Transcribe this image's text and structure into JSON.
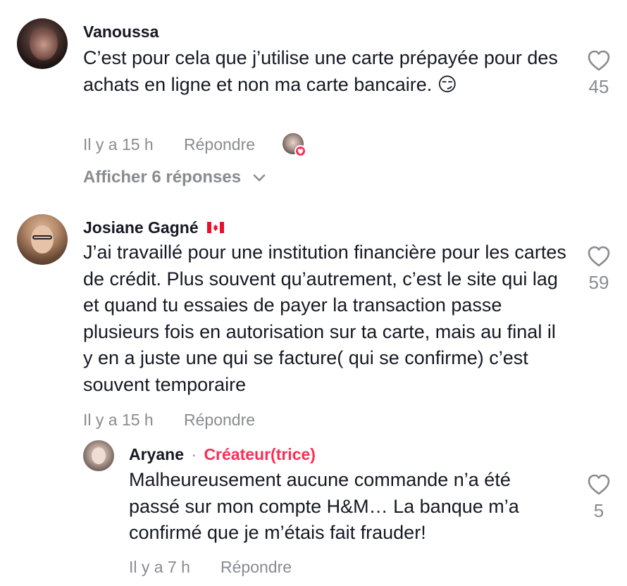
{
  "comments": [
    {
      "username": "Vanoussa",
      "text": "C’est pour cela que j’utilise une carte prépayée pour des achats en ligne et non ma carte bancaire. 😏",
      "time": "Il y a 15 h",
      "reply_label": "Répondre",
      "likes": "45",
      "view_replies": "Afficher 6 réponses",
      "creator_liked": true
    },
    {
      "username": "Josiane Gagné",
      "flag": "canada-flag",
      "text": "J’ai travaillé pour une institution financière pour les cartes de crédit. Plus souvent qu’autrement, c’est le site qui lag et quand tu essaies de payer la transaction passe plusieurs fois en autorisation sur ta carte, mais au final il y en a juste une qui se facture( qui se confirme) c’est souvent temporaire",
      "time": "Il y a 15 h",
      "reply_label": "Répondre",
      "likes": "59",
      "replies": [
        {
          "username": "Aryane",
          "separator": "·",
          "badge": "Créateur(trice)",
          "text": "Malheureusement aucune commande n’a été passé sur mon compte H&M… La banque m’a confirmé que je m’étais fait frauder!",
          "time": "Il y a 7 h",
          "reply_label": "Répondre",
          "likes": "5"
        }
      ]
    }
  ],
  "colors": {
    "text": "#161823",
    "muted": "#8a8b91",
    "accent": "#fe2c55",
    "background": "#ffffff"
  },
  "icons": [
    "heart-outline-icon",
    "chevron-down-icon",
    "creator-like-heart-icon"
  ]
}
